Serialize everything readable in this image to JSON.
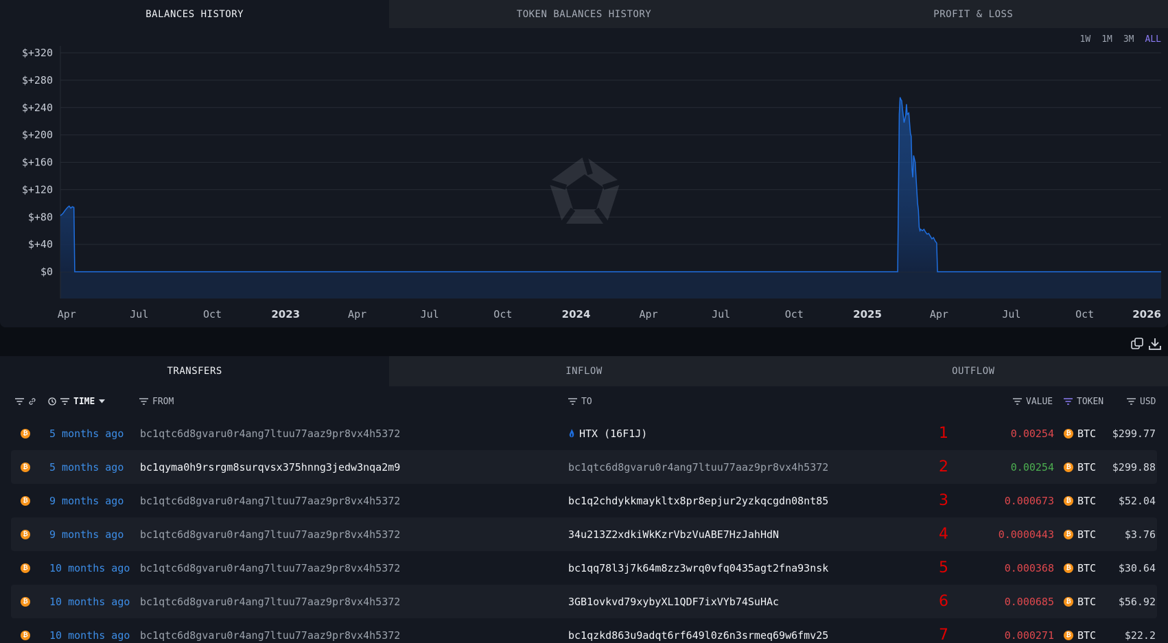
{
  "chart_tabs": [
    "BALANCES HISTORY",
    "TOKEN BALANCES HISTORY",
    "PROFIT & LOSS"
  ],
  "ranges": [
    "1W",
    "1M",
    "3M",
    "ALL"
  ],
  "accent_color": "#8b7cf6",
  "chart_data": {
    "type": "area",
    "title": "",
    "xlabel": "",
    "ylabel": "",
    "yticks": [
      "$+320",
      "$+280",
      "$+240",
      "$+200",
      "$+160",
      "$+120",
      "$+80",
      "$+40",
      "$0"
    ],
    "ylim": [
      -40,
      330
    ],
    "xticks": [
      "Apr",
      "Jul",
      "Oct",
      "2023",
      "Apr",
      "Jul",
      "Oct",
      "2024",
      "Apr",
      "Jul",
      "Oct",
      "2025",
      "Apr",
      "Jul",
      "Oct",
      "2026"
    ],
    "xlim": [
      "2022-03-24",
      "2026-01-05"
    ],
    "grid": true,
    "line_color": "#1f6fe0",
    "x": [
      "2022-03-24",
      "2022-03-27",
      "2022-03-30",
      "2022-04-02",
      "2022-04-04",
      "2022-04-06",
      "2022-04-08",
      "2022-04-10",
      "2022-04-11",
      "2025-02-08",
      "2025-02-10",
      "2025-02-11",
      "2025-02-12",
      "2025-02-13",
      "2025-02-14",
      "2025-02-16",
      "2025-02-18",
      "2025-02-19",
      "2025-02-20",
      "2025-02-22",
      "2025-02-24",
      "2025-02-25",
      "2025-02-26",
      "2025-02-27",
      "2025-02-28",
      "2025-03-02",
      "2025-03-04",
      "2025-03-05",
      "2025-03-06",
      "2025-03-07",
      "2025-03-08",
      "2025-03-09",
      "2025-03-11",
      "2025-03-13",
      "2025-03-15",
      "2025-03-17",
      "2025-03-19",
      "2025-03-21",
      "2025-03-23",
      "2025-03-25",
      "2025-03-27",
      "2025-03-29",
      "2025-03-30",
      "2026-01-05"
    ],
    "values": [
      82,
      85,
      90,
      94,
      96,
      93,
      95,
      94,
      0,
      0,
      230,
      255,
      252,
      250,
      238,
      218,
      228,
      245,
      230,
      232,
      202,
      198,
      150,
      138,
      170,
      160,
      120,
      100,
      90,
      65,
      60,
      62,
      60,
      62,
      58,
      55,
      56,
      52,
      48,
      50,
      45,
      42,
      0,
      0
    ]
  },
  "tools": {
    "copy": "copy-icon",
    "download": "download-icon"
  },
  "tx_tabs": [
    "TRANSFERS",
    "INFLOW",
    "OUTFLOW"
  ],
  "columns": {
    "time": "TIME",
    "from": "FROM",
    "to": "TO",
    "value": "VALUE",
    "token": "TOKEN",
    "usd": "USD"
  },
  "rows": [
    {
      "time": "5 months ago",
      "from": "bc1qtc6d8gvaru0r4ang7ltuu77aaz9pr8vx4h5372",
      "to": "HTX (16F1J)",
      "to_entity": true,
      "num": "1",
      "value": "0.00254",
      "dir": "out",
      "token": "BTC",
      "usd": "$299.77"
    },
    {
      "time": "5 months ago",
      "from": "bc1qyma0h9rsrgm8surqvsx375hnng3jedw3nqa2m9",
      "to": "bc1qtc6d8gvaru0r4ang7ltuu77aaz9pr8vx4h5372",
      "to_entity": false,
      "num": "2",
      "value": "0.00254",
      "dir": "in",
      "token": "BTC",
      "usd": "$299.88"
    },
    {
      "time": "9 months ago",
      "from": "bc1qtc6d8gvaru0r4ang7ltuu77aaz9pr8vx4h5372",
      "to": "bc1q2chdykkmaykltx8pr8epjur2yzkqcgdn08nt85",
      "to_entity": false,
      "num": "3",
      "value": "0.000673",
      "dir": "out",
      "token": "BTC",
      "usd": "$52.04"
    },
    {
      "time": "9 months ago",
      "from": "bc1qtc6d8gvaru0r4ang7ltuu77aaz9pr8vx4h5372",
      "to": "34u213Z2xdkiWkKzrVbzVuABE7HzJahHdN",
      "to_entity": false,
      "num": "4",
      "value": "0.0000443",
      "dir": "out",
      "token": "BTC",
      "usd": "$3.76"
    },
    {
      "time": "10 months ago",
      "from": "bc1qtc6d8gvaru0r4ang7ltuu77aaz9pr8vx4h5372",
      "to": "bc1qq78l3j7k64m8zz3wrq0vfq0435agt2fna93nsk",
      "to_entity": false,
      "num": "5",
      "value": "0.000368",
      "dir": "out",
      "token": "BTC",
      "usd": "$30.64"
    },
    {
      "time": "10 months ago",
      "from": "bc1qtc6d8gvaru0r4ang7ltuu77aaz9pr8vx4h5372",
      "to": "3GB1ovkvd79xybyXL1QDF7ixVYb74SuHAc",
      "to_entity": false,
      "num": "6",
      "value": "0.000685",
      "dir": "out",
      "token": "BTC",
      "usd": "$56.92"
    },
    {
      "time": "10 months ago",
      "from": "bc1qtc6d8gvaru0r4ang7ltuu77aaz9pr8vx4h5372",
      "to": "bc1qzkd863u9adqt6rf649l0z6n3srmeq69w6fmv25",
      "to_entity": false,
      "num": "7",
      "value": "0.000271",
      "dir": "out",
      "token": "BTC",
      "usd": "$22.2"
    }
  ]
}
